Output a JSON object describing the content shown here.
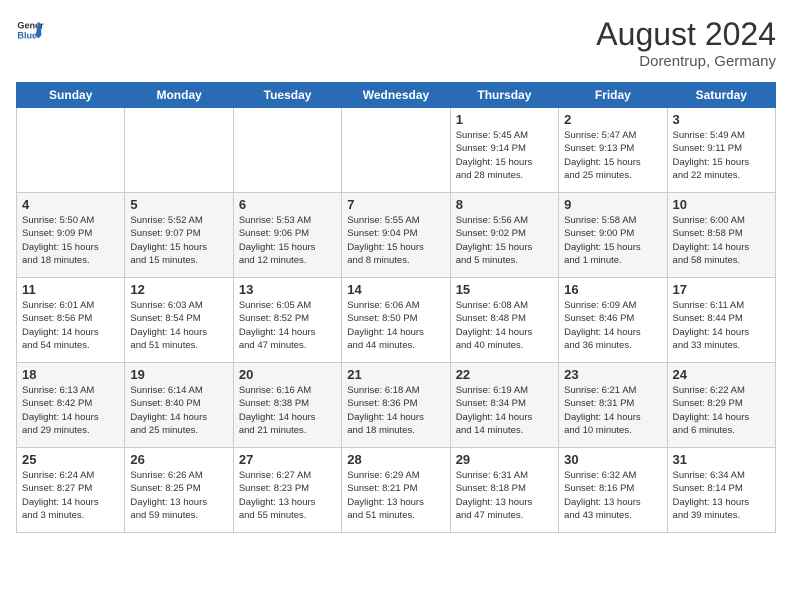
{
  "header": {
    "logo_general": "General",
    "logo_blue": "Blue",
    "month_year": "August 2024",
    "location": "Dorentrup, Germany"
  },
  "days_of_week": [
    "Sunday",
    "Monday",
    "Tuesday",
    "Wednesday",
    "Thursday",
    "Friday",
    "Saturday"
  ],
  "weeks": [
    [
      {
        "day": "",
        "info": ""
      },
      {
        "day": "",
        "info": ""
      },
      {
        "day": "",
        "info": ""
      },
      {
        "day": "",
        "info": ""
      },
      {
        "day": "1",
        "info": "Sunrise: 5:45 AM\nSunset: 9:14 PM\nDaylight: 15 hours\nand 28 minutes."
      },
      {
        "day": "2",
        "info": "Sunrise: 5:47 AM\nSunset: 9:13 PM\nDaylight: 15 hours\nand 25 minutes."
      },
      {
        "day": "3",
        "info": "Sunrise: 5:49 AM\nSunset: 9:11 PM\nDaylight: 15 hours\nand 22 minutes."
      }
    ],
    [
      {
        "day": "4",
        "info": "Sunrise: 5:50 AM\nSunset: 9:09 PM\nDaylight: 15 hours\nand 18 minutes."
      },
      {
        "day": "5",
        "info": "Sunrise: 5:52 AM\nSunset: 9:07 PM\nDaylight: 15 hours\nand 15 minutes."
      },
      {
        "day": "6",
        "info": "Sunrise: 5:53 AM\nSunset: 9:06 PM\nDaylight: 15 hours\nand 12 minutes."
      },
      {
        "day": "7",
        "info": "Sunrise: 5:55 AM\nSunset: 9:04 PM\nDaylight: 15 hours\nand 8 minutes."
      },
      {
        "day": "8",
        "info": "Sunrise: 5:56 AM\nSunset: 9:02 PM\nDaylight: 15 hours\nand 5 minutes."
      },
      {
        "day": "9",
        "info": "Sunrise: 5:58 AM\nSunset: 9:00 PM\nDaylight: 15 hours\nand 1 minute."
      },
      {
        "day": "10",
        "info": "Sunrise: 6:00 AM\nSunset: 8:58 PM\nDaylight: 14 hours\nand 58 minutes."
      }
    ],
    [
      {
        "day": "11",
        "info": "Sunrise: 6:01 AM\nSunset: 8:56 PM\nDaylight: 14 hours\nand 54 minutes."
      },
      {
        "day": "12",
        "info": "Sunrise: 6:03 AM\nSunset: 8:54 PM\nDaylight: 14 hours\nand 51 minutes."
      },
      {
        "day": "13",
        "info": "Sunrise: 6:05 AM\nSunset: 8:52 PM\nDaylight: 14 hours\nand 47 minutes."
      },
      {
        "day": "14",
        "info": "Sunrise: 6:06 AM\nSunset: 8:50 PM\nDaylight: 14 hours\nand 44 minutes."
      },
      {
        "day": "15",
        "info": "Sunrise: 6:08 AM\nSunset: 8:48 PM\nDaylight: 14 hours\nand 40 minutes."
      },
      {
        "day": "16",
        "info": "Sunrise: 6:09 AM\nSunset: 8:46 PM\nDaylight: 14 hours\nand 36 minutes."
      },
      {
        "day": "17",
        "info": "Sunrise: 6:11 AM\nSunset: 8:44 PM\nDaylight: 14 hours\nand 33 minutes."
      }
    ],
    [
      {
        "day": "18",
        "info": "Sunrise: 6:13 AM\nSunset: 8:42 PM\nDaylight: 14 hours\nand 29 minutes."
      },
      {
        "day": "19",
        "info": "Sunrise: 6:14 AM\nSunset: 8:40 PM\nDaylight: 14 hours\nand 25 minutes."
      },
      {
        "day": "20",
        "info": "Sunrise: 6:16 AM\nSunset: 8:38 PM\nDaylight: 14 hours\nand 21 minutes."
      },
      {
        "day": "21",
        "info": "Sunrise: 6:18 AM\nSunset: 8:36 PM\nDaylight: 14 hours\nand 18 minutes."
      },
      {
        "day": "22",
        "info": "Sunrise: 6:19 AM\nSunset: 8:34 PM\nDaylight: 14 hours\nand 14 minutes."
      },
      {
        "day": "23",
        "info": "Sunrise: 6:21 AM\nSunset: 8:31 PM\nDaylight: 14 hours\nand 10 minutes."
      },
      {
        "day": "24",
        "info": "Sunrise: 6:22 AM\nSunset: 8:29 PM\nDaylight: 14 hours\nand 6 minutes."
      }
    ],
    [
      {
        "day": "25",
        "info": "Sunrise: 6:24 AM\nSunset: 8:27 PM\nDaylight: 14 hours\nand 3 minutes."
      },
      {
        "day": "26",
        "info": "Sunrise: 6:26 AM\nSunset: 8:25 PM\nDaylight: 13 hours\nand 59 minutes."
      },
      {
        "day": "27",
        "info": "Sunrise: 6:27 AM\nSunset: 8:23 PM\nDaylight: 13 hours\nand 55 minutes."
      },
      {
        "day": "28",
        "info": "Sunrise: 6:29 AM\nSunset: 8:21 PM\nDaylight: 13 hours\nand 51 minutes."
      },
      {
        "day": "29",
        "info": "Sunrise: 6:31 AM\nSunset: 8:18 PM\nDaylight: 13 hours\nand 47 minutes."
      },
      {
        "day": "30",
        "info": "Sunrise: 6:32 AM\nSunset: 8:16 PM\nDaylight: 13 hours\nand 43 minutes."
      },
      {
        "day": "31",
        "info": "Sunrise: 6:34 AM\nSunset: 8:14 PM\nDaylight: 13 hours\nand 39 minutes."
      }
    ]
  ]
}
